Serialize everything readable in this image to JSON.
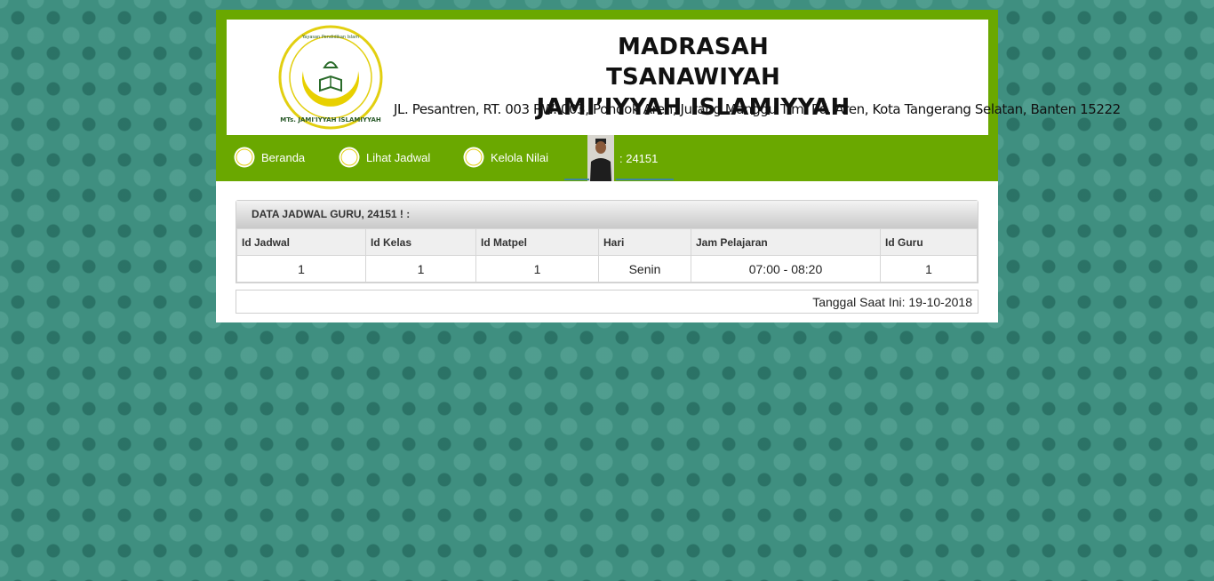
{
  "header": {
    "title_line1": "MADRASAH TSANAWIYAH",
    "title_line2": "JAMI’IYYAH ISLAMIYYAH",
    "address": "JL. Pesantren, RT. 003 RW. 003, Pondok Aren, Jurang Manggu Tim. Pd. Aren, Kota Tangerang Selatan, Banten 15222",
    "logo_text_bottom": "MTs. JAMI'IYYAH ISLAMIYYAH",
    "logo_text_top": "Yayasan Pendidikan Islam"
  },
  "nav": {
    "items": [
      {
        "label": "Beranda",
        "icon": "school-logo-icon"
      },
      {
        "label": "Lihat Jadwal",
        "icon": "school-logo-icon"
      },
      {
        "label": "Kelola Nilai",
        "icon": "school-logo-icon"
      }
    ],
    "user_label": ":  24151"
  },
  "panel": {
    "title": "DATA JADWAL GURU, 24151 ! :",
    "columns": [
      "Id Jadwal",
      "Id Kelas",
      "Id Matpel",
      "Hari",
      "Jam Pelajaran",
      "Id Guru"
    ],
    "rows": [
      [
        "1",
        "1",
        "1",
        "Senin",
        "07:00 - 08:20",
        "1"
      ]
    ]
  },
  "footer": {
    "date_text": "Tanggal Saat Ini: 19-10-2018"
  },
  "colors": {
    "nav_green": "#6aa800",
    "background_teal": "#3f8f80",
    "logo_yellow": "#e8d000"
  }
}
